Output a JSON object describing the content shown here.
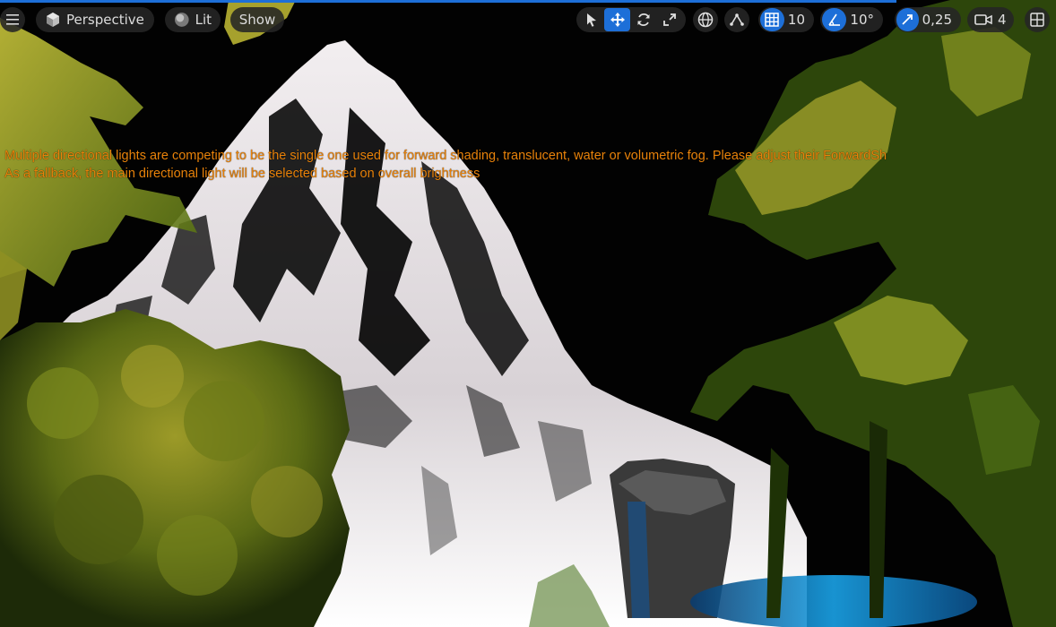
{
  "toolbar": {
    "menu_icon": "hamburger-icon",
    "perspective_label": "Perspective",
    "perspective_icon": "cube-icon",
    "lit_label": "Lit",
    "lit_icon": "sphere-icon",
    "show_label": "Show",
    "transform_tools": [
      "select-arrow-icon",
      "move-icon",
      "rotate-icon",
      "scale-icon"
    ],
    "active_tool": "move-icon",
    "world_local_icon": "globe-icon",
    "surface_snap_icon": "surface-snap-icon",
    "grid_snap_value": "10",
    "rotation_snap_value": "10°",
    "scale_snap_value": "0,25",
    "camera_speed_value": "4",
    "layout_icon": "viewport-layout-icon",
    "accent_color": "#1d6fd8"
  },
  "warning": {
    "line1": "Multiple directional lights are competing to be the single one used for forward shading, translucent, water or volumetric fog. Please adjust their ForwardSh",
    "line2": "As a fallback, the main directional light will be selected based on overall brightness",
    "color": "#e8820a"
  }
}
